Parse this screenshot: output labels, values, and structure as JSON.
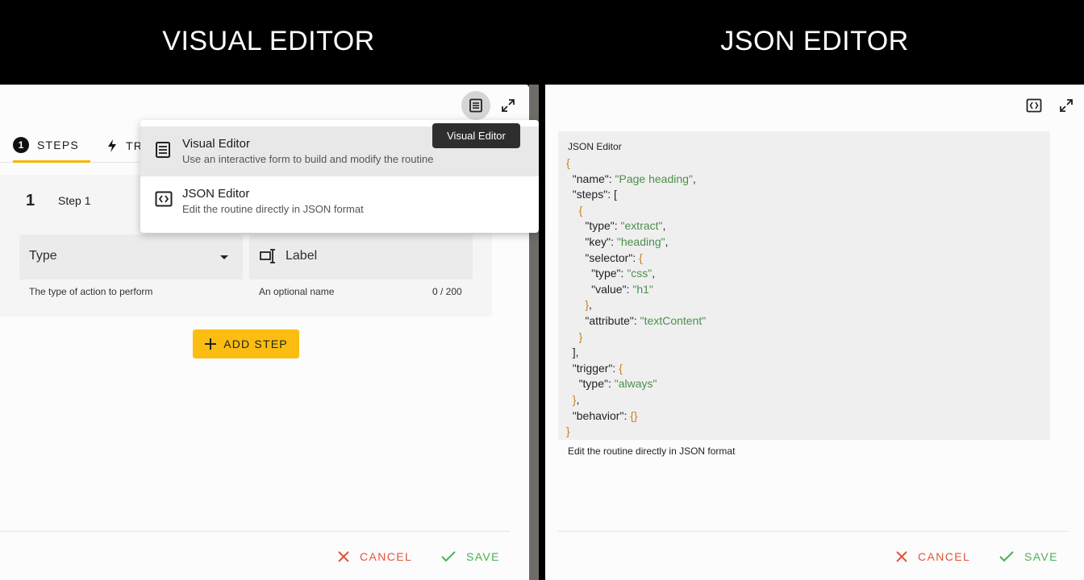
{
  "banner": {
    "left_title": "VISUAL EDITOR",
    "right_title": "JSON EDITOR"
  },
  "visual_editor": {
    "tabs": [
      {
        "label": "STEPS",
        "badge": "1"
      },
      {
        "label": "TR"
      }
    ],
    "step": {
      "number": "1",
      "title": "Step 1",
      "type_field": {
        "value": "Type",
        "helper": "The type of action to perform"
      },
      "label_field": {
        "placeholder": "Label",
        "helper": "An optional name",
        "counter": "0 / 200"
      }
    },
    "add_step_label": "ADD STEP",
    "cancel_label": "CANCEL",
    "save_label": "SAVE",
    "menu": [
      {
        "title": "Visual Editor",
        "description": "Use an interactive form to build and modify the routine",
        "icon": "visual-editor-icon"
      },
      {
        "title": "JSON Editor",
        "description": "Edit the routine directly in JSON format",
        "icon": "json-editor-icon"
      }
    ],
    "tooltip": "Visual Editor"
  },
  "json_editor": {
    "box_label": "JSON Editor",
    "helper": "Edit the routine directly in JSON format",
    "cancel_label": "CANCEL",
    "save_label": "SAVE",
    "routine": {
      "name": "Page heading",
      "step_type": "extract",
      "step_key": "heading",
      "selector_type": "css",
      "selector_value": "h1",
      "attribute": "textContent",
      "trigger_type": "always"
    }
  },
  "colors": {
    "accent": "#fbbd12",
    "cancel": "#e0553a",
    "save": "#4caf50",
    "json_string": "#4a8f4a",
    "json_brace": "#c4821c"
  }
}
